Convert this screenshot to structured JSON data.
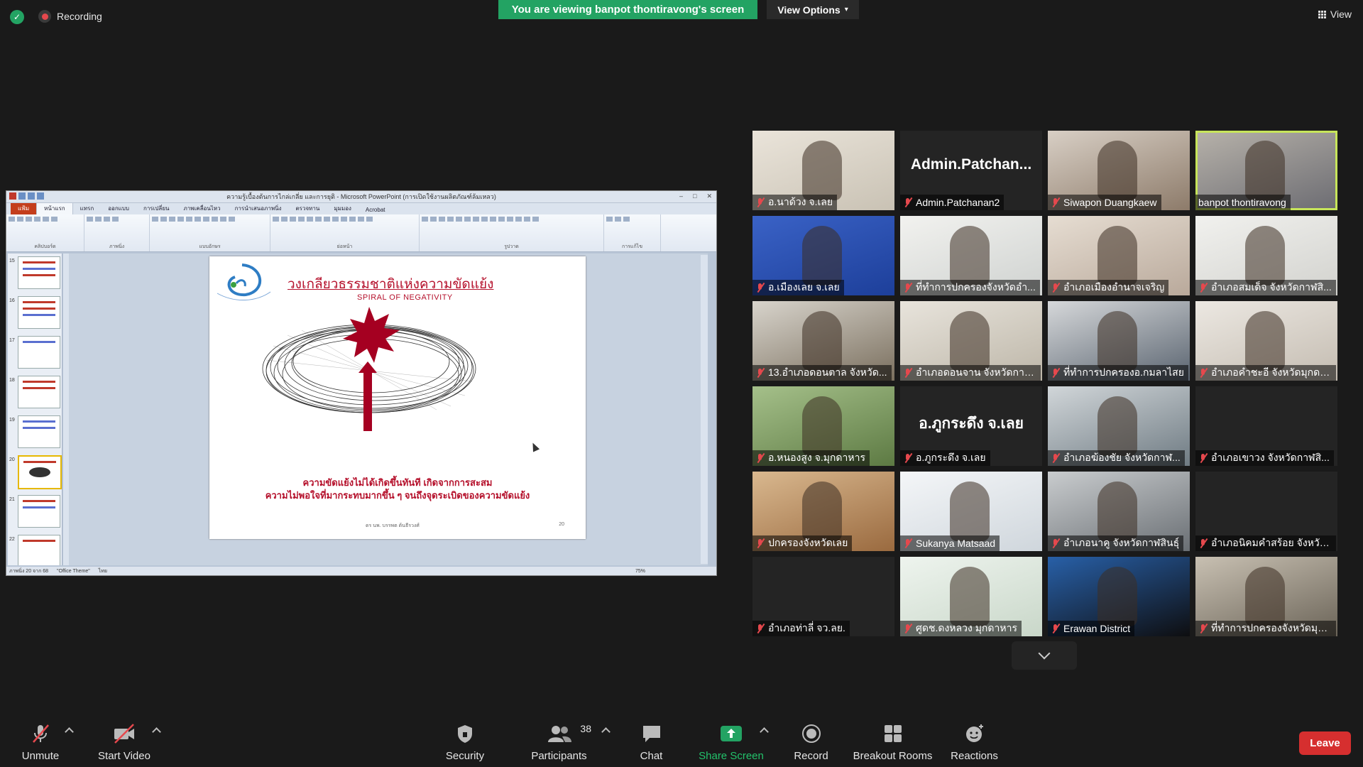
{
  "topbar": {
    "recording_label": "Recording",
    "viewing_banner": "You are viewing banpot thontiravong's screen",
    "view_options_label": "View Options",
    "view_label": "View"
  },
  "shared_screen": {
    "window_title": "ความรู้เบื้องต้นการไกล่เกลี่ย และการยุติ - Microsoft PowerPoint (การเปิดใช้งานผลิตภัณฑ์ล้มเหลว)",
    "ribbon_tabs": [
      "แฟ้ม",
      "หน้าแรก",
      "แทรก",
      "ออกแบบ",
      "การเปลี่ยน",
      "ภาพเคลื่อนไหว",
      "การนำเสนอภาพนิ่ง",
      "ตรวจทาน",
      "มุมมอง",
      "Acrobat"
    ],
    "ribbon_groups": [
      "คลิปบอร์ด",
      "ภาพนิ่ง",
      "แบบอักษร",
      "ย่อหน้า",
      "รูปวาด",
      "การแก้ไข"
    ],
    "thumbnail_numbers": [
      "15",
      "16",
      "17",
      "18",
      "19",
      "20",
      "21",
      "22"
    ],
    "slide": {
      "title": "วงเกลียวธรรมชาติแห่งความขัดแย้ง",
      "subtitle": "SPIRAL OF NEGATIVITY",
      "caption_line1": "ความขัดแย้งไม่ได้เกิดขึ้นทันที เกิดจากการสะสม",
      "caption_line2": "ความไม่พอใจที่มากระทบมากขึ้น ๆ จนถึงจุดระเบิดของความขัดแย้ง",
      "footer_author": "ดร นพ. บรรพต ต้นธีรวงศ์",
      "page_number": "20"
    },
    "status_bar": {
      "slide_info": "ภาพนิ่ง 20 จาก 68",
      "theme": "\"Office Theme\"",
      "language": "ไทย",
      "zoom": "75%"
    }
  },
  "participants": [
    {
      "name": "อ.นาด้วง จ.เลย",
      "muted": true,
      "video": true
    },
    {
      "name": "Admin.Patchanan2",
      "muted": true,
      "video": false,
      "display": "Admin.Patchan..."
    },
    {
      "name": "Siwapon Duangkaew",
      "muted": true,
      "video": true
    },
    {
      "name": "banpot thontiravong",
      "muted": false,
      "video": true,
      "active": true
    },
    {
      "name": "อ.เมืองเลย จ.เลย",
      "muted": true,
      "video": true
    },
    {
      "name": "ที่ทำการปกครองจังหวัดอำ...",
      "muted": true,
      "video": true
    },
    {
      "name": "อำเภอเมืองอำนาจเจริญ",
      "muted": true,
      "video": true
    },
    {
      "name": "อำเภอสมเด็จ จังหวัดกาฬสิ...",
      "muted": true,
      "video": true
    },
    {
      "name": "13.อำเภอดอนตาล จังหวัด...",
      "muted": true,
      "video": true
    },
    {
      "name": "อำเภอดอนจาน จังหวัดกาฬ...",
      "muted": true,
      "video": true
    },
    {
      "name": "ที่ทำการปกครองอ.กมลาไสย",
      "muted": true,
      "video": true
    },
    {
      "name": "อำเภอคำชะอี จังหวัดมุกดา...",
      "muted": true,
      "video": true
    },
    {
      "name": "อ.หนองสูง จ.มุกดาหาร",
      "muted": true,
      "video": true
    },
    {
      "name": "อ.ภูกระดึง จ.เลย",
      "muted": true,
      "video": false,
      "display": "อ.ภูกระดึง จ.เลย"
    },
    {
      "name": "อำเภอฆ้องชัย จังหวัดกาฬ...",
      "muted": true,
      "video": true
    },
    {
      "name": "อำเภอเขาวง จังหวัดกาฬสิ...",
      "muted": true,
      "video": false
    },
    {
      "name": "ปกครองจังหวัดเลย",
      "muted": true,
      "video": true
    },
    {
      "name": "Sukanya Matsaad",
      "muted": true,
      "video": true
    },
    {
      "name": "อำเภอนาคู จังหวัดกาฬสินธุ์",
      "muted": true,
      "video": true
    },
    {
      "name": "อำเภอนิคมคำสร้อย จังหวัด...",
      "muted": true,
      "video": false
    },
    {
      "name": "อำเภอท่าลี่ จว.ลย.",
      "muted": true,
      "video": false
    },
    {
      "name": "ศูดช.ดงหลวง มุกดาหาร",
      "muted": true,
      "video": true
    },
    {
      "name": "Erawan District",
      "muted": true,
      "video": true
    },
    {
      "name": "ที่ทำการปกครองจังหวัดมุก...",
      "muted": true,
      "video": true
    }
  ],
  "toolbar": {
    "unmute": "Unmute",
    "start_video": "Start Video",
    "security": "Security",
    "participants": "Participants",
    "participants_count": "38",
    "chat": "Chat",
    "share_screen": "Share Screen",
    "record": "Record",
    "breakout_rooms": "Breakout Rooms",
    "reactions": "Reactions",
    "leave": "Leave"
  },
  "colors": {
    "accent_green": "#23a363",
    "leave_red": "#d62f2f",
    "active_speaker": "#c7e55a",
    "slide_red": "#b5102b"
  }
}
